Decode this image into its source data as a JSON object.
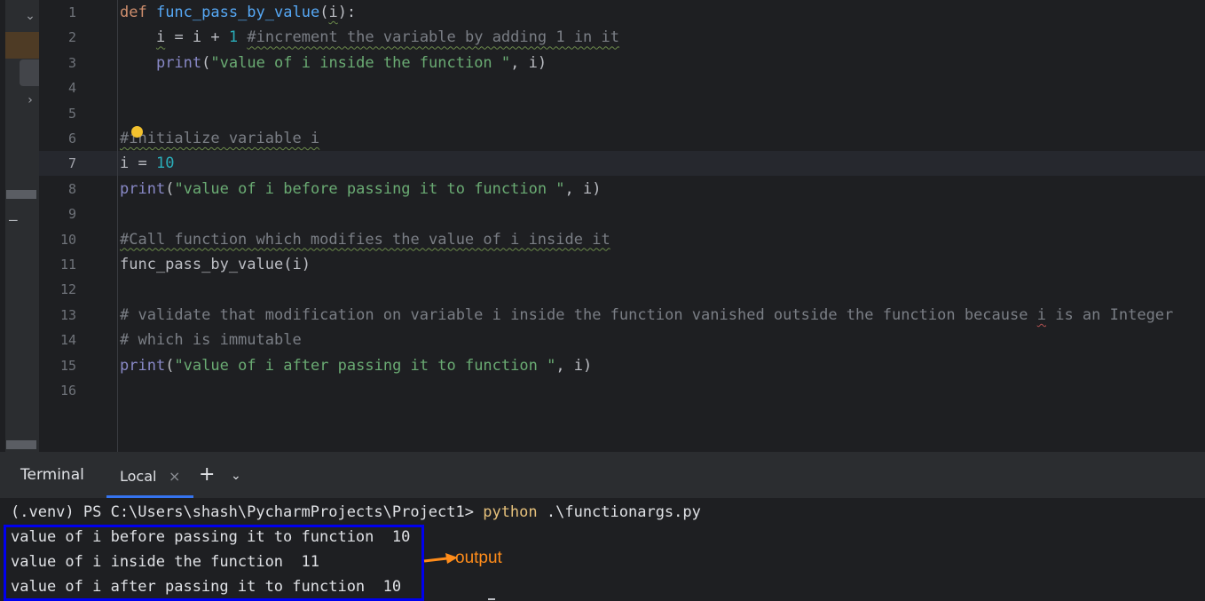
{
  "editor": {
    "current_line": 7,
    "lines": [
      {
        "n": "1",
        "segs": [
          {
            "t": "def ",
            "c": "kw"
          },
          {
            "t": "func_pass_by_value",
            "c": "fn"
          },
          {
            "t": "(",
            "c": ""
          },
          {
            "t": "i",
            "c": "wv"
          },
          {
            "t": "):",
            "c": ""
          }
        ]
      },
      {
        "n": "2",
        "segs": [
          {
            "t": "    ",
            "c": ""
          },
          {
            "t": "i",
            "c": "wv"
          },
          {
            "t": " = i + ",
            "c": ""
          },
          {
            "t": "1",
            "c": "num"
          },
          {
            "t": " ",
            "c": ""
          },
          {
            "t": "#increment the variable by adding 1 in it",
            "c": "cm wv"
          }
        ]
      },
      {
        "n": "3",
        "segs": [
          {
            "t": "    ",
            "c": ""
          },
          {
            "t": "print",
            "c": "bi"
          },
          {
            "t": "(",
            "c": ""
          },
          {
            "t": "\"value of i inside the function \"",
            "c": "str"
          },
          {
            "t": ", i)",
            "c": ""
          }
        ]
      },
      {
        "n": "4",
        "segs": []
      },
      {
        "n": "5",
        "segs": []
      },
      {
        "n": "6",
        "segs": [
          {
            "t": "#initialize variable i",
            "c": "cm wv"
          }
        ]
      },
      {
        "n": "7",
        "segs": [
          {
            "t": "i = ",
            "c": ""
          },
          {
            "t": "10",
            "c": "num"
          }
        ]
      },
      {
        "n": "8",
        "segs": [
          {
            "t": "print",
            "c": "bi"
          },
          {
            "t": "(",
            "c": ""
          },
          {
            "t": "\"value of i before passing it to function \"",
            "c": "str"
          },
          {
            "t": ", i)",
            "c": ""
          }
        ]
      },
      {
        "n": "9",
        "segs": []
      },
      {
        "n": "10",
        "segs": [
          {
            "t": "#Call function which modifies the value of i inside it",
            "c": "cm wv"
          }
        ]
      },
      {
        "n": "11",
        "segs": [
          {
            "t": "func_pass_by_value(i)",
            "c": ""
          }
        ]
      },
      {
        "n": "12",
        "segs": []
      },
      {
        "n": "13",
        "segs": [
          {
            "t": "# validate that modification on variable i inside the function vanished outside the function because ",
            "c": "cm"
          },
          {
            "t": "i",
            "c": "cm wvr"
          },
          {
            "t": " is an Integer",
            "c": "cm"
          }
        ]
      },
      {
        "n": "14",
        "segs": [
          {
            "t": "# which is immutable",
            "c": "cm"
          }
        ]
      },
      {
        "n": "15",
        "segs": [
          {
            "t": "print",
            "c": "bi"
          },
          {
            "t": "(",
            "c": ""
          },
          {
            "t": "\"value of i after passing it to function \"",
            "c": "str"
          },
          {
            "t": ", i)",
            "c": ""
          }
        ]
      },
      {
        "n": "16",
        "segs": []
      }
    ]
  },
  "terminal": {
    "title": "Terminal",
    "tab_label": "Local",
    "close_glyph": "×",
    "add_glyph": "+",
    "dropdown_glyph": "⌄",
    "prompt": "(.venv) PS C:\\Users\\shash\\PycharmProjects\\Project1> ",
    "command_python": "python",
    "command_args": " .\\functionargs.py",
    "output": [
      "value of i before passing it to function  10",
      "value of i inside the function  11",
      "value of i after passing it to function  10"
    ]
  },
  "annotation": {
    "label": "output",
    "color": "#ff8c1a",
    "box_color": "#0000ee"
  },
  "icons": {
    "collapse": "chevron-down-icon",
    "expand": "chevron-right-icon",
    "minimize": "minus-icon",
    "intention": "lightbulb-icon"
  }
}
